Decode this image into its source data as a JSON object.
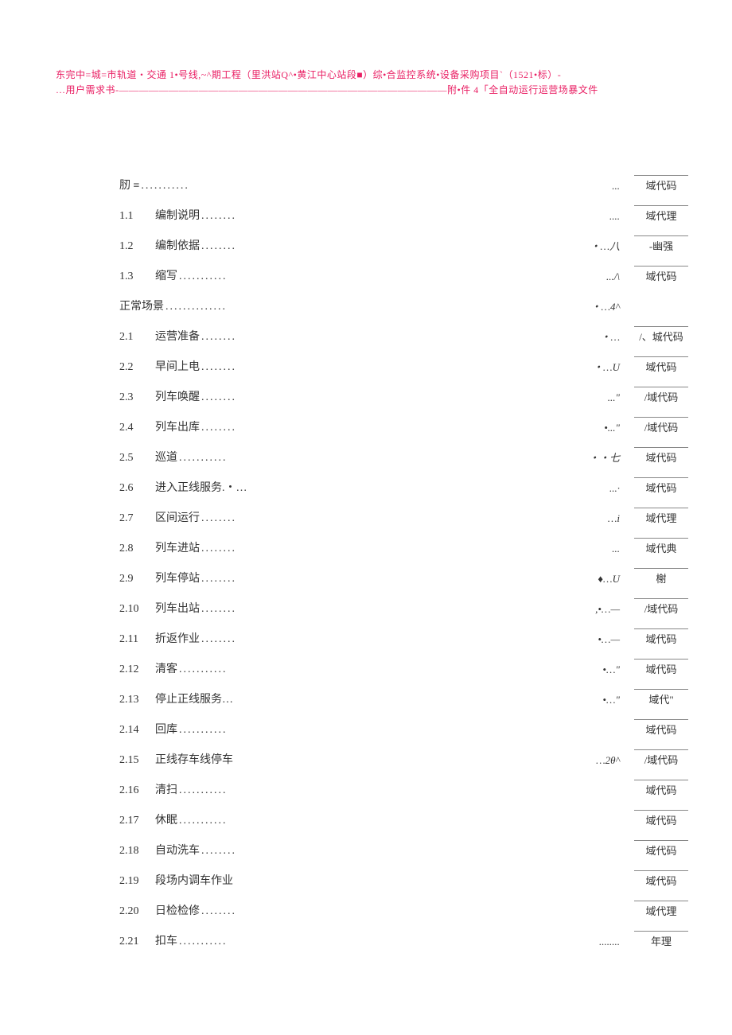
{
  "header": {
    "line1": "东完中=城=市轨道・交通 1•号线,~^期工程（里洪站Q^•黄江中心站段■）综•合监控系统•设备采购项目`（1521•标）-",
    "line2": "…用户需求书-—————————————————————————————————附•件 4「全自动运行运营场暴文件"
  },
  "toc": [
    {
      "num": "",
      "title": "肕 ≡",
      "dots": "...........",
      "mid": "...",
      "right": "域代码",
      "first": true
    },
    {
      "num": "1.1",
      "title": "编制说明",
      "dots": "........",
      "mid": "....",
      "right": "域代理"
    },
    {
      "num": "1.2",
      "title": "编制依据",
      "dots": "........",
      "mid": "・…八",
      "right": "-幽强"
    },
    {
      "num": "1.3",
      "title": "缩写",
      "dots": "...........",
      "mid": ".../\\",
      "right": "域代码"
    },
    {
      "num": "",
      "title": "正常场景",
      "dots": "..............",
      "mid": "・…4^",
      "right": "",
      "section": true
    },
    {
      "num": "2.1",
      "title": "运营准备",
      "dots": "........",
      "mid": "・…",
      "right": "/、城代码"
    },
    {
      "num": "2.2",
      "title": "早间上电",
      "dots": "........",
      "mid": "・…U",
      "right": "域代码"
    },
    {
      "num": "2.3",
      "title": "列车唤醒",
      "dots": "........",
      "mid": "...\"",
      "right": "/域代码"
    },
    {
      "num": "2.4",
      "title": "列车出库",
      "dots": "........",
      "mid": "•...\"",
      "right": "/域代码"
    },
    {
      "num": "2.5",
      "title": "巡道",
      "dots": "...........",
      "mid": "・・七",
      "right": "域代码"
    },
    {
      "num": "2.6",
      "title": "进入正线服务.・…",
      "dots": "",
      "mid": "...·",
      "right": "域代码"
    },
    {
      "num": "2.7",
      "title": "区间运行",
      "dots": "........",
      "mid": "…i",
      "right": "域代理"
    },
    {
      "num": "2.8",
      "title": "列车进站",
      "dots": "........",
      "mid": "...",
      "right": "域代典"
    },
    {
      "num": "2.9",
      "title": "列车停站",
      "dots": "........",
      "mid": "♦…U",
      "right": "榭"
    },
    {
      "num": "2.10",
      "title": "列车出站",
      "dots": "........",
      "mid": ",•…—",
      "right": "/域代码"
    },
    {
      "num": "2.11",
      "title": "折返作业",
      "dots": "........",
      "mid": "•…—",
      "right": "域代码"
    },
    {
      "num": "2.12",
      "title": "清客",
      "dots": "...........",
      "mid": "•…\"",
      "right": "域代码"
    },
    {
      "num": "2.13",
      "title": "停止正线服务…",
      "dots": "",
      "mid": "•…\"",
      "right": "域代\""
    },
    {
      "num": "2.14",
      "title": "回库",
      "dots": "...........",
      "mid": "",
      "right": "域代码"
    },
    {
      "num": "2.15",
      "title": "正线存车线停车",
      "dots": "",
      "mid": "…2θ^",
      "right": "/域代码"
    },
    {
      "num": "2.16",
      "title": "清扫",
      "dots": "...........",
      "mid": "",
      "right": "域代码"
    },
    {
      "num": "2.17",
      "title": "休眠",
      "dots": "...........",
      "mid": "",
      "right": "域代码"
    },
    {
      "num": "2.18",
      "title": "自动洗车",
      "dots": "........",
      "mid": "",
      "right": "域代码"
    },
    {
      "num": "2.19",
      "title": "段场内调车作业",
      "dots": "",
      "mid": "",
      "right": "域代码"
    },
    {
      "num": "2.20",
      "title": "日检检修",
      "dots": "........",
      "mid": "",
      "right": "域代理"
    },
    {
      "num": "2.21",
      "title": "扣车",
      "dots": "...........",
      "mid": "........",
      "right": "年理"
    }
  ]
}
